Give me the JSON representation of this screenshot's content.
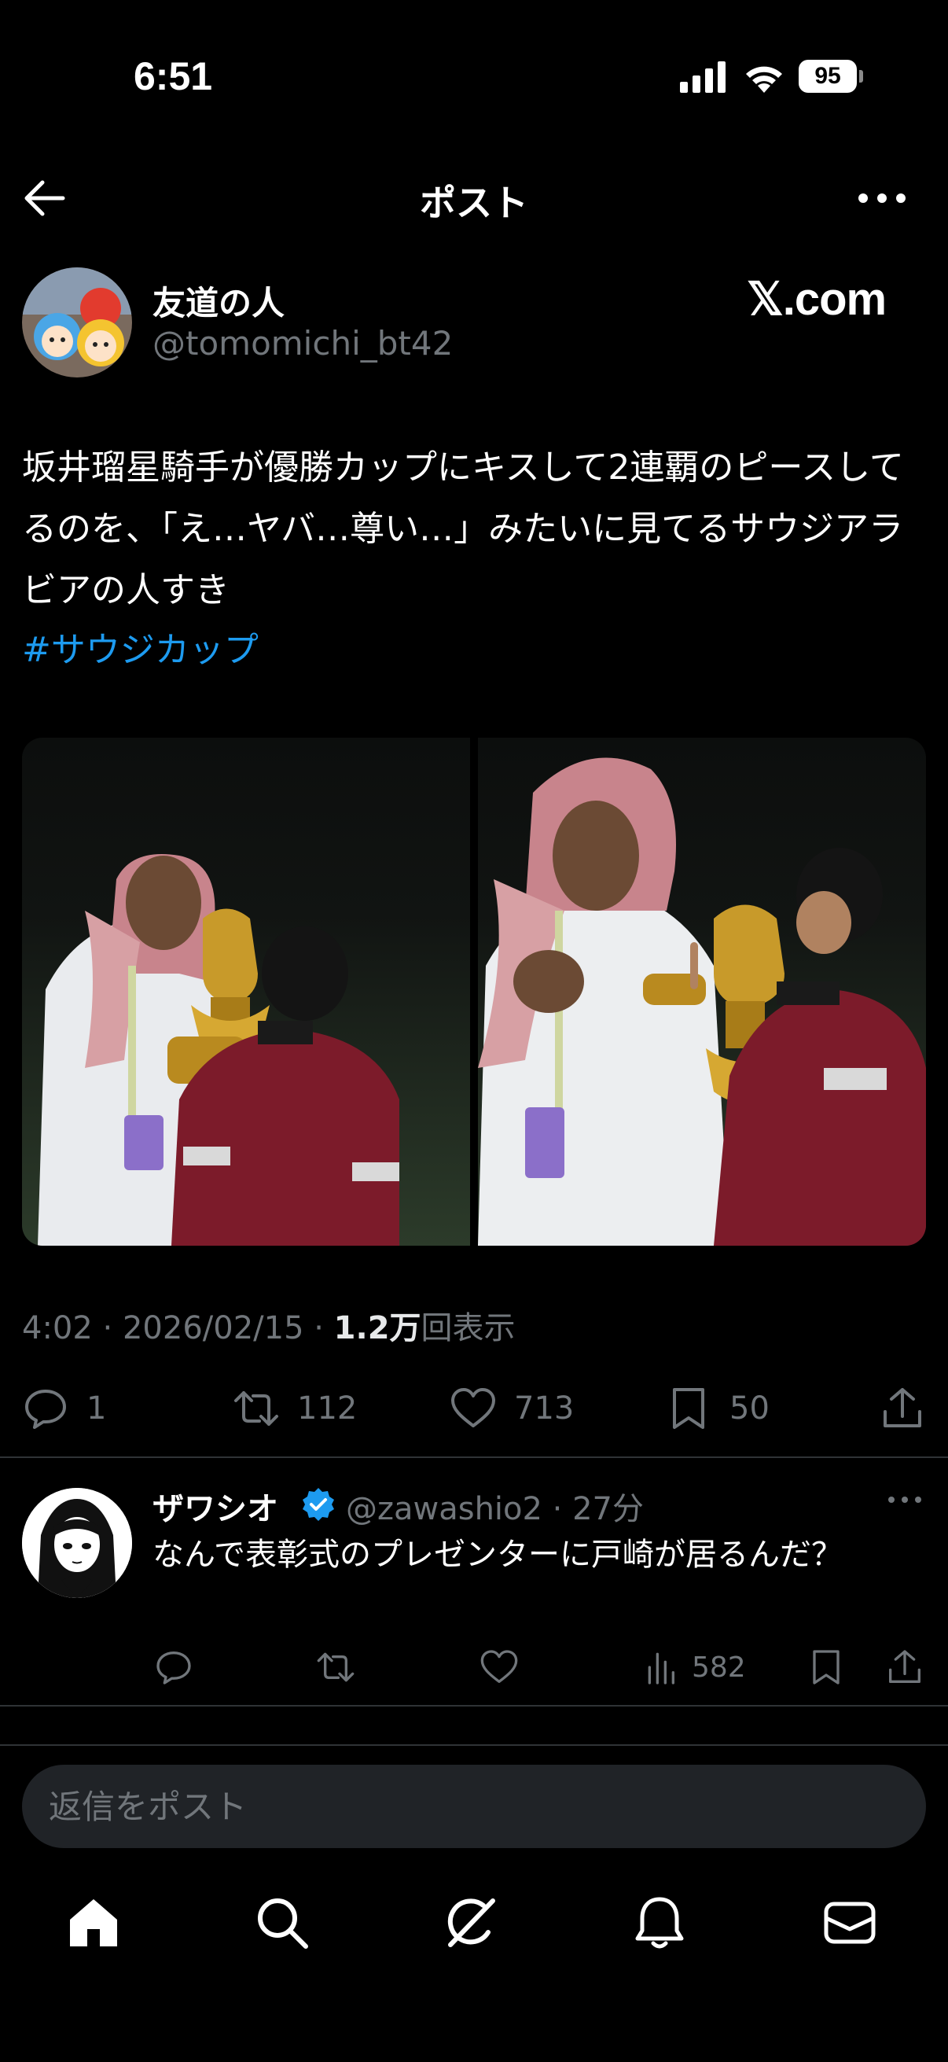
{
  "status_bar": {
    "time": "6:51",
    "battery": "95"
  },
  "header": {
    "title": "ポスト"
  },
  "post": {
    "author_name": "友道の人",
    "author_handle": "@tomomichi_bt42",
    "watermark": "𝕏.com",
    "text": "坂井瑠星騎手が優勝カップにキスして2連覇のピースしてるのを、「え…ヤバ…尊い…」みたいに見てるサウジアラビアの人すき",
    "hashtag": "#サウジカップ",
    "timestamp": "4:02 · 2026/02/15 · ",
    "views_count": "1.2万",
    "views_label": "回表示",
    "stats": {
      "replies": "1",
      "reposts": "112",
      "likes": "713",
      "bookmarks": "50"
    }
  },
  "reply": {
    "name": "ザワシオ",
    "handle": "@zawashio2 · 27分",
    "text": "なんで表彰式のプレゼンターに戸崎が居るんだ？",
    "views": "582"
  },
  "composer": {
    "placeholder": "返信をポスト"
  },
  "tabs": [
    "home-icon",
    "search-icon",
    "grok-icon",
    "notifications-icon",
    "messages-icon"
  ],
  "colors": {
    "accent": "#1d9bf0",
    "background": "#000000",
    "muted": "#71767b",
    "divider": "#2f3336"
  }
}
